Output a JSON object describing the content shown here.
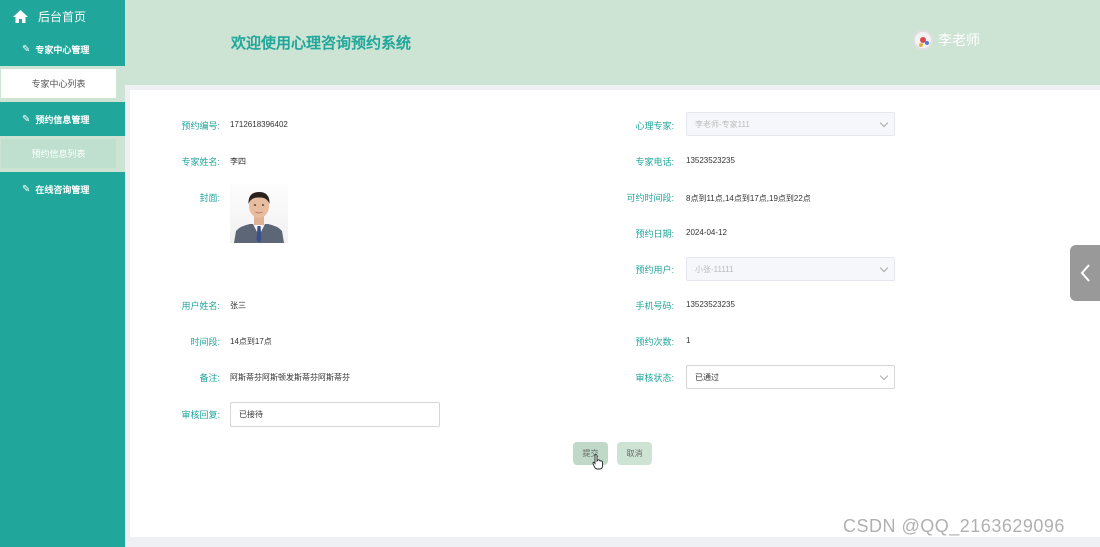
{
  "sidebar": {
    "home_label": "后台首页",
    "groups": [
      {
        "label": "专家中心管理",
        "items": [
          {
            "label": "专家中心列表"
          }
        ]
      },
      {
        "label": "预约信息管理",
        "items": [
          {
            "label": "预约信息列表"
          }
        ]
      },
      {
        "label": "在线咨询管理"
      }
    ]
  },
  "header": {
    "title": "欢迎使用心理咨询预约系统",
    "user_name": "李老师"
  },
  "form": {
    "booking_no": {
      "label": "预约编号:",
      "value": "1712618396402"
    },
    "expert": {
      "label": "心理专家:",
      "value": "李老师-专家111"
    },
    "expert_name": {
      "label": "专家姓名:",
      "value": "李四"
    },
    "expert_phone": {
      "label": "专家电话:",
      "value": "13523523235"
    },
    "cover": {
      "label": "封面:"
    },
    "available_slots": {
      "label": "可约时间段:",
      "value": "8点到11点,14点到17点,19点到22点"
    },
    "booking_date": {
      "label": "预约日期:",
      "value": "2024-04-12"
    },
    "booking_user": {
      "label": "预约用户:",
      "value": "小张-11111"
    },
    "user_name": {
      "label": "用户姓名:",
      "value": "张三"
    },
    "mobile": {
      "label": "手机号码:",
      "value": "13523523235"
    },
    "time_slot": {
      "label": "时间段:",
      "value": "14点到17点"
    },
    "booking_count": {
      "label": "预约次数:",
      "value": "1"
    },
    "remark": {
      "label": "备注:",
      "value": "阿斯蒂芬阿斯顿发斯蒂芬阿斯蒂芬"
    },
    "review_status": {
      "label": "审核状态:",
      "value": "已通过"
    },
    "review_reply": {
      "label": "审核回复:",
      "value": "已接待"
    }
  },
  "buttons": {
    "submit": "提交",
    "cancel": "取消"
  },
  "watermark": "CSDN @QQ_2163629096",
  "colors": {
    "accent": "#20a69a",
    "header_bg": "#cde3d3",
    "toggle_bg": "#999999"
  },
  "icons": {
    "home": "home-icon",
    "menu": "edit-icon",
    "toggle": "chevron-left-icon"
  }
}
